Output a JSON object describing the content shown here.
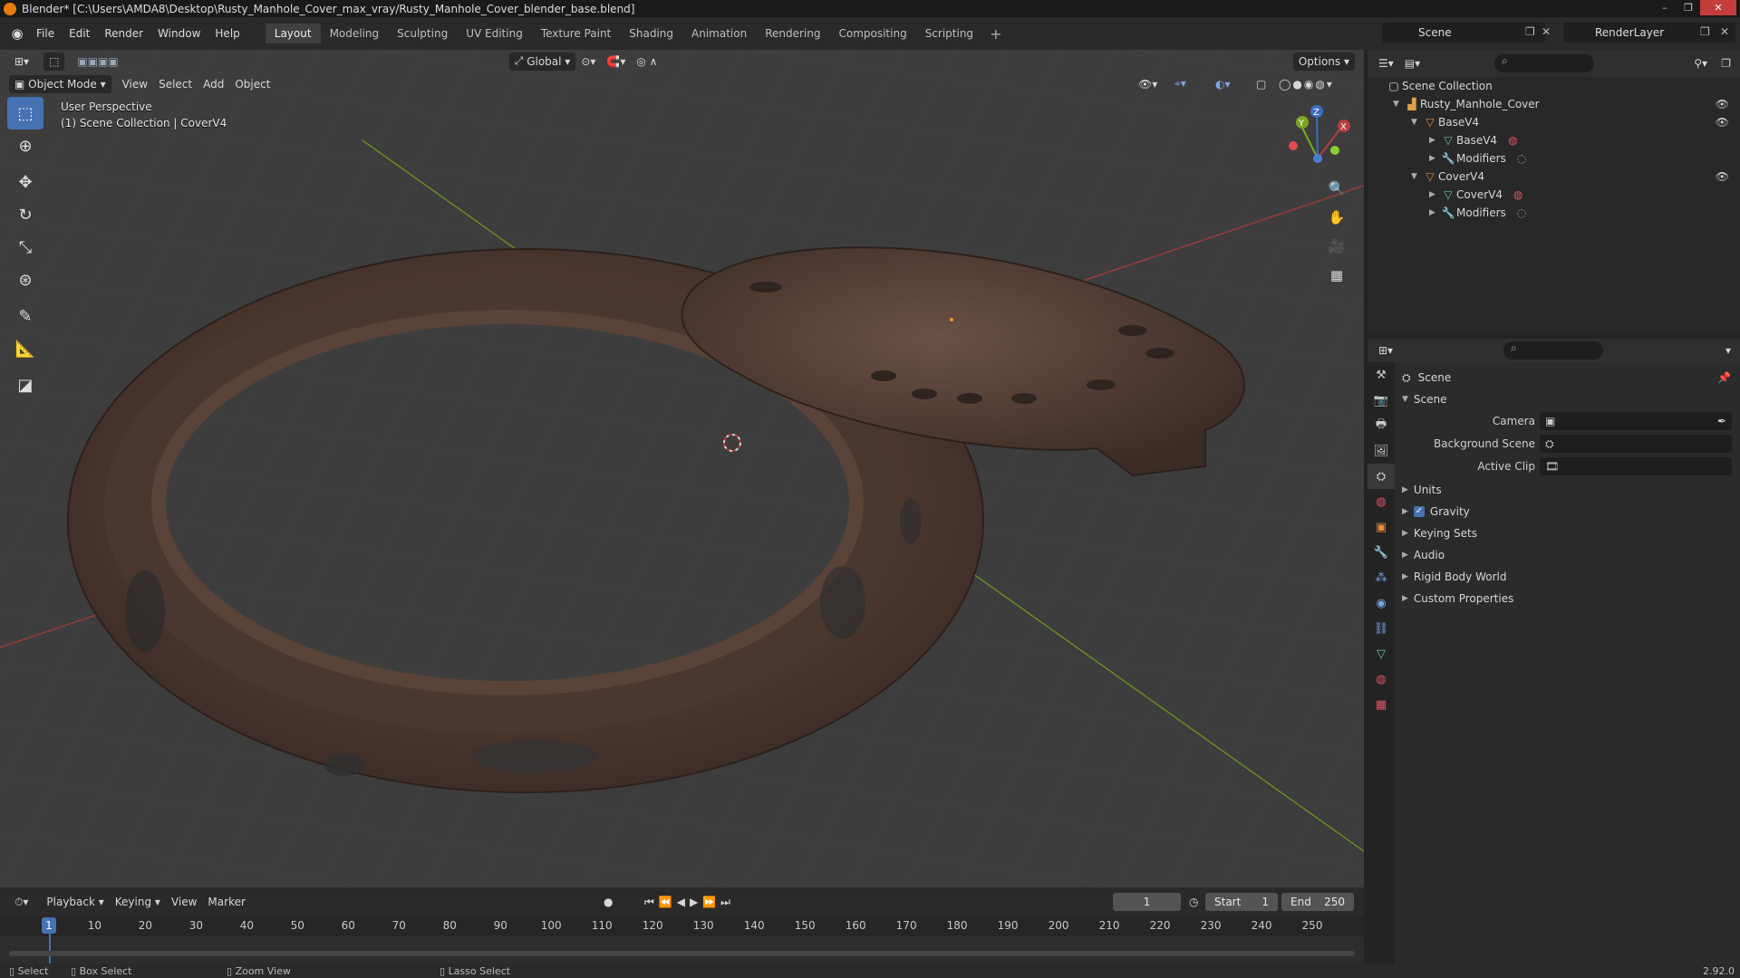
{
  "titlebar": {
    "title": "Blender* [C:\\Users\\AMDA8\\Desktop\\Rusty_Manhole_Cover_max_vray/Rusty_Manhole_Cover_blender_base.blend]",
    "min": "–",
    "max": "❐",
    "close": "✕"
  },
  "menu": {
    "items": [
      "File",
      "Edit",
      "Render",
      "Window",
      "Help"
    ]
  },
  "workspaces": [
    "Layout",
    "Modeling",
    "Sculpting",
    "UV Editing",
    "Texture Paint",
    "Shading",
    "Animation",
    "Rendering",
    "Compositing",
    "Scripting"
  ],
  "workspace_add": "+",
  "scene_name": "Scene",
  "renderlayer_name": "RenderLayer",
  "viewport": {
    "transform_orientation": "Global",
    "options_label": "Options",
    "mode": "Object Mode",
    "menu": [
      "View",
      "Select",
      "Add",
      "Object"
    ],
    "info_line1": "User Perspective",
    "info_line2": "(1) Scene Collection | CoverV4",
    "gizmo": {
      "x": "X",
      "y": "Y",
      "z": "Z"
    }
  },
  "outliner": {
    "root": "Scene Collection",
    "collection": "Rusty_Manhole_Cover",
    "items": [
      {
        "label": "BaseV4"
      },
      {
        "label": "BaseV4"
      },
      {
        "label": "Modifiers"
      },
      {
        "label": "CoverV4"
      },
      {
        "label": "CoverV4"
      },
      {
        "label": "Modifiers"
      }
    ]
  },
  "properties": {
    "context": "Scene",
    "panel": "Scene",
    "camera_label": "Camera",
    "bgscene_label": "Background Scene",
    "clip_label": "Active Clip",
    "subpanels": [
      "Units",
      "Gravity",
      "Keying Sets",
      "Audio",
      "Rigid Body World",
      "Custom Properties"
    ],
    "gravity_checked": true
  },
  "timeline": {
    "menu": [
      "Playback",
      "Keying",
      "View",
      "Marker"
    ],
    "current_frame": "1",
    "start_label": "Start",
    "start": "1",
    "end_label": "End",
    "end": "250",
    "ticks": [
      "1",
      "10",
      "20",
      "30",
      "40",
      "50",
      "60",
      "70",
      "80",
      "90",
      "100",
      "110",
      "120",
      "130",
      "140",
      "150",
      "160",
      "170",
      "180",
      "190",
      "200",
      "210",
      "220",
      "230",
      "240",
      "250"
    ]
  },
  "status": {
    "select": "Select",
    "box_select": "Box Select",
    "zoom_view": "Zoom View",
    "lasso_select": "Lasso Select",
    "version": "2.92.0"
  },
  "colors": {
    "accent": "#4772b3",
    "x_axis": "#9b3a3a",
    "y_axis": "#6b8c1e",
    "rust": "#5a4236"
  }
}
